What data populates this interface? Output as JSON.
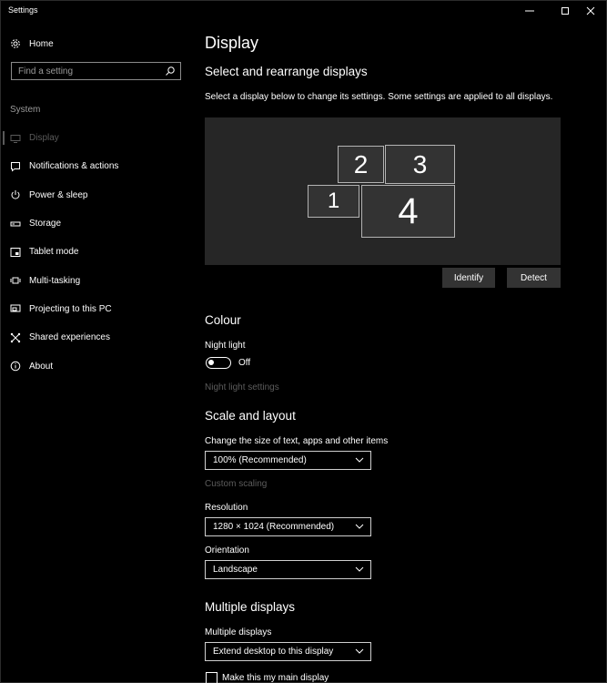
{
  "window": {
    "title": "Settings"
  },
  "sidebar": {
    "home_label": "Home",
    "search_placeholder": "Find a setting",
    "section_label": "System",
    "items": [
      {
        "label": "Display",
        "icon": "monitor-icon",
        "selected": true
      },
      {
        "label": "Notifications & actions",
        "icon": "notification-icon"
      },
      {
        "label": "Power & sleep",
        "icon": "power-icon"
      },
      {
        "label": "Storage",
        "icon": "storage-icon"
      },
      {
        "label": "Tablet mode",
        "icon": "tablet-mode-icon"
      },
      {
        "label": "Multi-tasking",
        "icon": "multitasking-icon"
      },
      {
        "label": "Projecting to this PC",
        "icon": "projecting-icon"
      },
      {
        "label": "Shared experiences",
        "icon": "shared-experiences-icon"
      },
      {
        "label": "About",
        "icon": "info-icon"
      }
    ]
  },
  "main": {
    "title": "Display",
    "rearrange": {
      "heading": "Select and rearrange displays",
      "description": "Select a display below to change its settings. Some settings are applied to all displays.",
      "monitors": [
        "2",
        "3",
        "1",
        "4"
      ],
      "identify_label": "Identify",
      "detect_label": "Detect"
    },
    "colour": {
      "heading": "Colour",
      "night_light_label": "Night light",
      "night_light_state": "Off",
      "night_light_on": false,
      "night_light_settings_link": "Night light settings"
    },
    "scale": {
      "heading": "Scale and layout",
      "size_label": "Change the size of text, apps and other items",
      "size_value": "100% (Recommended)",
      "custom_scaling_link": "Custom scaling",
      "resolution_label": "Resolution",
      "resolution_value": "1280 × 1024 (Recommended)",
      "orientation_label": "Orientation",
      "orientation_value": "Landscape"
    },
    "multiple": {
      "heading": "Multiple displays",
      "label": "Multiple displays",
      "value": "Extend desktop to this display",
      "main_display_label": "Make this my main display",
      "main_display_checked": false
    }
  },
  "colors": {
    "background": "#000000",
    "panel": "#262626",
    "button": "#333333",
    "disabled_text": "#5c5c5c"
  }
}
